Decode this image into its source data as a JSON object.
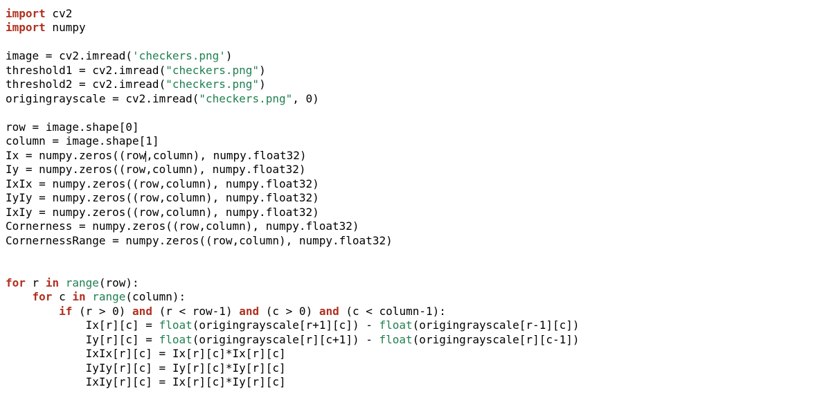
{
  "code": {
    "lines": [
      [
        {
          "cls": "kw",
          "t": "import"
        },
        {
          "cls": "id",
          "t": " cv2"
        }
      ],
      [
        {
          "cls": "kw",
          "t": "import"
        },
        {
          "cls": "id",
          "t": " numpy"
        }
      ],
      [],
      [
        {
          "cls": "id",
          "t": "image"
        },
        {
          "cls": "op",
          "t": " = "
        },
        {
          "cls": "id",
          "t": "cv2.imread("
        },
        {
          "cls": "str",
          "t": "'checkers.png'"
        },
        {
          "cls": "id",
          "t": ")"
        }
      ],
      [
        {
          "cls": "id",
          "t": "threshold1"
        },
        {
          "cls": "op",
          "t": " = "
        },
        {
          "cls": "id",
          "t": "cv2.imread("
        },
        {
          "cls": "str",
          "t": "\"checkers.png\""
        },
        {
          "cls": "id",
          "t": ")"
        }
      ],
      [
        {
          "cls": "id",
          "t": "threshold2"
        },
        {
          "cls": "op",
          "t": " = "
        },
        {
          "cls": "id",
          "t": "cv2.imread("
        },
        {
          "cls": "str",
          "t": "\"checkers.png\""
        },
        {
          "cls": "id",
          "t": ")"
        }
      ],
      [
        {
          "cls": "id",
          "t": "origingrayscale"
        },
        {
          "cls": "op",
          "t": " = "
        },
        {
          "cls": "id",
          "t": "cv2.imread("
        },
        {
          "cls": "str",
          "t": "\"checkers.png\""
        },
        {
          "cls": "id",
          "t": ", "
        },
        {
          "cls": "num",
          "t": "0"
        },
        {
          "cls": "id",
          "t": ")"
        }
      ],
      [],
      [
        {
          "cls": "id",
          "t": "row"
        },
        {
          "cls": "op",
          "t": " = "
        },
        {
          "cls": "id",
          "t": "image.shape["
        },
        {
          "cls": "num",
          "t": "0"
        },
        {
          "cls": "id",
          "t": "]"
        }
      ],
      [
        {
          "cls": "id",
          "t": "column"
        },
        {
          "cls": "op",
          "t": " = "
        },
        {
          "cls": "id",
          "t": "image.shape["
        },
        {
          "cls": "num",
          "t": "1"
        },
        {
          "cls": "id",
          "t": "]"
        }
      ],
      [
        {
          "cls": "id",
          "t": "Ix"
        },
        {
          "cls": "op",
          "t": " = "
        },
        {
          "cls": "id",
          "t": "numpy.zeros((row"
        },
        {
          "cursor": true
        },
        {
          "cls": "id",
          "t": ",column), numpy.float32)"
        }
      ],
      [
        {
          "cls": "id",
          "t": "Iy"
        },
        {
          "cls": "op",
          "t": " = "
        },
        {
          "cls": "id",
          "t": "numpy.zeros((row,column), numpy.float32)"
        }
      ],
      [
        {
          "cls": "id",
          "t": "IxIx"
        },
        {
          "cls": "op",
          "t": " = "
        },
        {
          "cls": "id",
          "t": "numpy.zeros((row,column), numpy.float32)"
        }
      ],
      [
        {
          "cls": "id",
          "t": "IyIy"
        },
        {
          "cls": "op",
          "t": " = "
        },
        {
          "cls": "id",
          "t": "numpy.zeros((row,column), numpy.float32)"
        }
      ],
      [
        {
          "cls": "id",
          "t": "IxIy"
        },
        {
          "cls": "op",
          "t": " = "
        },
        {
          "cls": "id",
          "t": "numpy.zeros((row,column), numpy.float32)"
        }
      ],
      [
        {
          "cls": "id",
          "t": "Cornerness"
        },
        {
          "cls": "op",
          "t": " = "
        },
        {
          "cls": "id",
          "t": "numpy.zeros((row,column), numpy.float32)"
        }
      ],
      [
        {
          "cls": "id",
          "t": "CornernessRange"
        },
        {
          "cls": "op",
          "t": " = "
        },
        {
          "cls": "id",
          "t": "numpy.zeros((row,column), numpy.float32)"
        }
      ],
      [],
      [],
      [
        {
          "cls": "kw",
          "t": "for"
        },
        {
          "cls": "id",
          "t": " r "
        },
        {
          "cls": "kw",
          "t": "in"
        },
        {
          "cls": "id",
          "t": " "
        },
        {
          "cls": "bi",
          "t": "range"
        },
        {
          "cls": "id",
          "t": "(row):"
        }
      ],
      [
        {
          "cls": "id",
          "t": "    "
        },
        {
          "cls": "kw",
          "t": "for"
        },
        {
          "cls": "id",
          "t": " c "
        },
        {
          "cls": "kw",
          "t": "in"
        },
        {
          "cls": "id",
          "t": " "
        },
        {
          "cls": "bi",
          "t": "range"
        },
        {
          "cls": "id",
          "t": "(column):"
        }
      ],
      [
        {
          "cls": "id",
          "t": "        "
        },
        {
          "cls": "kw",
          "t": "if"
        },
        {
          "cls": "id",
          "t": " (r "
        },
        {
          "cls": "op",
          "t": ">"
        },
        {
          "cls": "id",
          "t": " "
        },
        {
          "cls": "num",
          "t": "0"
        },
        {
          "cls": "id",
          "t": ") "
        },
        {
          "cls": "kw",
          "t": "and"
        },
        {
          "cls": "id",
          "t": " (r "
        },
        {
          "cls": "op",
          "t": "<"
        },
        {
          "cls": "id",
          "t": " row"
        },
        {
          "cls": "op",
          "t": "-"
        },
        {
          "cls": "num",
          "t": "1"
        },
        {
          "cls": "id",
          "t": ") "
        },
        {
          "cls": "kw",
          "t": "and"
        },
        {
          "cls": "id",
          "t": " (c "
        },
        {
          "cls": "op",
          "t": ">"
        },
        {
          "cls": "id",
          "t": " "
        },
        {
          "cls": "num",
          "t": "0"
        },
        {
          "cls": "id",
          "t": ") "
        },
        {
          "cls": "kw",
          "t": "and"
        },
        {
          "cls": "id",
          "t": " (c "
        },
        {
          "cls": "op",
          "t": "<"
        },
        {
          "cls": "id",
          "t": " column"
        },
        {
          "cls": "op",
          "t": "-"
        },
        {
          "cls": "num",
          "t": "1"
        },
        {
          "cls": "id",
          "t": "):"
        }
      ],
      [
        {
          "cls": "id",
          "t": "            Ix[r][c]"
        },
        {
          "cls": "op",
          "t": " = "
        },
        {
          "cls": "bi",
          "t": "float"
        },
        {
          "cls": "id",
          "t": "(origingrayscale[r"
        },
        {
          "cls": "op",
          "t": "+"
        },
        {
          "cls": "num",
          "t": "1"
        },
        {
          "cls": "id",
          "t": "][c]) "
        },
        {
          "cls": "op",
          "t": "-"
        },
        {
          "cls": "id",
          "t": " "
        },
        {
          "cls": "bi",
          "t": "float"
        },
        {
          "cls": "id",
          "t": "(origingrayscale[r"
        },
        {
          "cls": "op",
          "t": "-"
        },
        {
          "cls": "num",
          "t": "1"
        },
        {
          "cls": "id",
          "t": "][c])"
        }
      ],
      [
        {
          "cls": "id",
          "t": "            Iy[r][c]"
        },
        {
          "cls": "op",
          "t": " = "
        },
        {
          "cls": "bi",
          "t": "float"
        },
        {
          "cls": "id",
          "t": "(origingrayscale[r][c"
        },
        {
          "cls": "op",
          "t": "+"
        },
        {
          "cls": "num",
          "t": "1"
        },
        {
          "cls": "id",
          "t": "]) "
        },
        {
          "cls": "op",
          "t": "-"
        },
        {
          "cls": "id",
          "t": " "
        },
        {
          "cls": "bi",
          "t": "float"
        },
        {
          "cls": "id",
          "t": "(origingrayscale[r][c"
        },
        {
          "cls": "op",
          "t": "-"
        },
        {
          "cls": "num",
          "t": "1"
        },
        {
          "cls": "id",
          "t": "])"
        }
      ],
      [
        {
          "cls": "id",
          "t": "            IxIx[r][c]"
        },
        {
          "cls": "op",
          "t": " = "
        },
        {
          "cls": "id",
          "t": "Ix[r][c]"
        },
        {
          "cls": "op",
          "t": "*"
        },
        {
          "cls": "id",
          "t": "Ix[r][c]"
        }
      ],
      [
        {
          "cls": "id",
          "t": "            IyIy[r][c]"
        },
        {
          "cls": "op",
          "t": " = "
        },
        {
          "cls": "id",
          "t": "Iy[r][c]"
        },
        {
          "cls": "op",
          "t": "*"
        },
        {
          "cls": "id",
          "t": "Iy[r][c]"
        }
      ],
      [
        {
          "cls": "id",
          "t": "            IxIy[r][c]"
        },
        {
          "cls": "op",
          "t": " = "
        },
        {
          "cls": "id",
          "t": "Ix[r][c]"
        },
        {
          "cls": "op",
          "t": "*"
        },
        {
          "cls": "id",
          "t": "Iy[r][c]"
        }
      ]
    ]
  }
}
